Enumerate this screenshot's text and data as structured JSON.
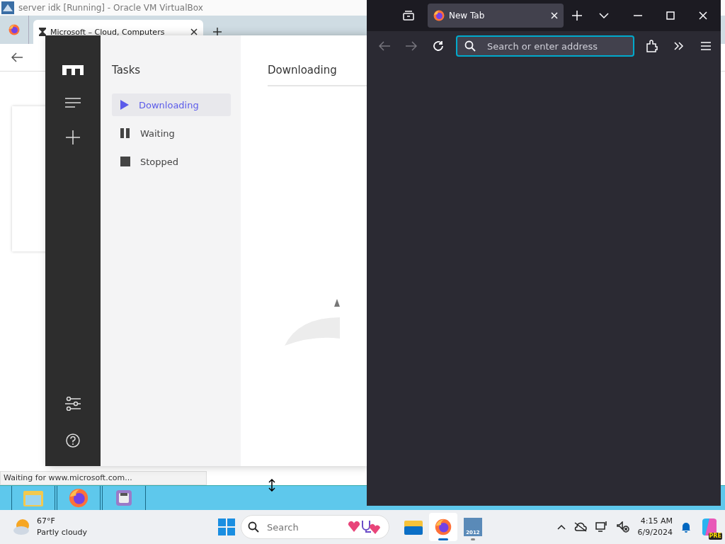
{
  "vm_window": {
    "title": "server idk [Running] - Oracle VM VirtualBox",
    "browser_tab": {
      "title": "Microsoft – Cloud, Computers"
    },
    "status": "Waiting for www.microsoft.com...",
    "guest_taskbar": [
      {
        "kind": "folder"
      },
      {
        "kind": "firefox"
      },
      {
        "kind": "app"
      }
    ]
  },
  "motrix": {
    "section_title": "Tasks",
    "items": [
      {
        "label": "Downloading",
        "kind": "play",
        "selected": true
      },
      {
        "label": "Waiting",
        "kind": "pause",
        "selected": false
      },
      {
        "label": "Stopped",
        "kind": "stop",
        "selected": false
      }
    ],
    "content_title": "Downloading"
  },
  "firefox": {
    "tab_title": "New Tab",
    "address_placeholder": "Search or enter address"
  },
  "taskbar": {
    "weather_temp": "67°F",
    "weather_desc": "Partly cloudy",
    "search_placeholder": "Search",
    "apps": [
      {
        "kind": "explorer",
        "running": false,
        "selected": false
      },
      {
        "kind": "firefox",
        "running": true,
        "selected": true
      },
      {
        "kind": "vbox",
        "label": "2012",
        "running": true,
        "selected": false
      }
    ],
    "time": "4:15 AM",
    "date": "6/9/2024",
    "copilot_badge": "PRE"
  }
}
